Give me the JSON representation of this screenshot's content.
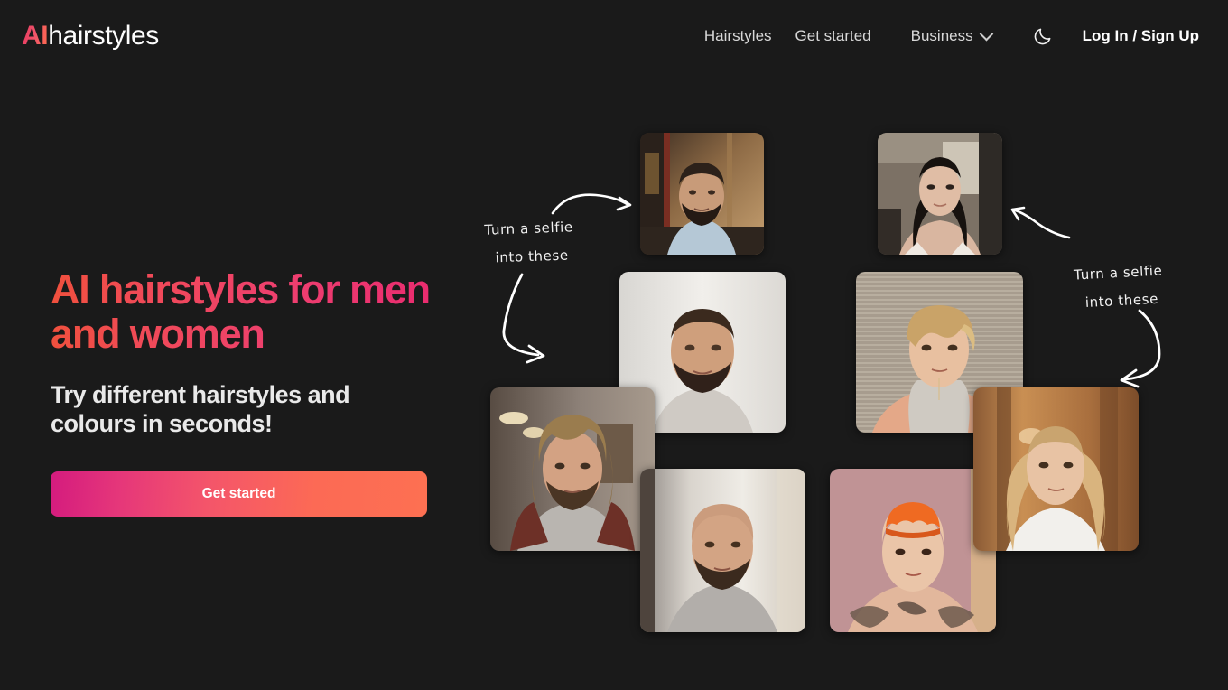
{
  "header": {
    "logo": {
      "accent": "AI",
      "rest": "hairstyles",
      "accent_color": "#e8355f"
    },
    "nav": [
      {
        "label": "Hairstyles",
        "name": "nav-hairstyles"
      },
      {
        "label": "Get started",
        "name": "nav-get-started"
      }
    ],
    "dropdown": {
      "label": "Business",
      "icon": "chevron-down-icon"
    },
    "theme_toggle": {
      "icon": "moon-icon",
      "mode": "dark"
    },
    "auth": {
      "label": "Log In / Sign Up"
    }
  },
  "hero": {
    "title_line1": "AI hairstyles for men",
    "title_line2": "and women",
    "title": "AI hairstyles for men and women",
    "subtitle_line1": "Try different hairstyles and",
    "subtitle_line2": "colours in seconds!",
    "cta_label": "Get started",
    "gradient_start": "#f0503d",
    "gradient_end": "#e8266f"
  },
  "annotations": [
    {
      "line1": "Turn a selfie",
      "line2": "into these",
      "side": "left"
    },
    {
      "line1": "Turn a selfie",
      "line2": "into these",
      "side": "right"
    }
  ],
  "collage": {
    "photos": [
      {
        "id": "selfie-man-indoor",
        "alt": "Man with dark hair and beard in light blue t-shirt, warm indoor room"
      },
      {
        "id": "selfie-woman-dark",
        "alt": "Woman with long straight dark hair in white tank top, beige wall"
      },
      {
        "id": "result-man-fade",
        "alt": "Man with short cropped fade haircut and beard, light grey shirt"
      },
      {
        "id": "result-woman-blonde-pixie",
        "alt": "Woman with short blonde pixie cut, grey tank top, textured wall"
      },
      {
        "id": "result-man-long-hair",
        "alt": "Man with long wavy brown hair and beard, brown leather jacket"
      },
      {
        "id": "result-man-bald",
        "alt": "Bald man with goatee beard in grey t-shirt, bright background"
      },
      {
        "id": "result-woman-orange",
        "alt": "Woman with bright orange buzzed undercut and chest tattoos, pink wall"
      },
      {
        "id": "result-woman-blonde-long",
        "alt": "Woman with long wavy blonde hair in white top, warm blurred background"
      }
    ]
  },
  "theme": {
    "background": "#1a1a1a",
    "text": "#e8e8e8"
  }
}
